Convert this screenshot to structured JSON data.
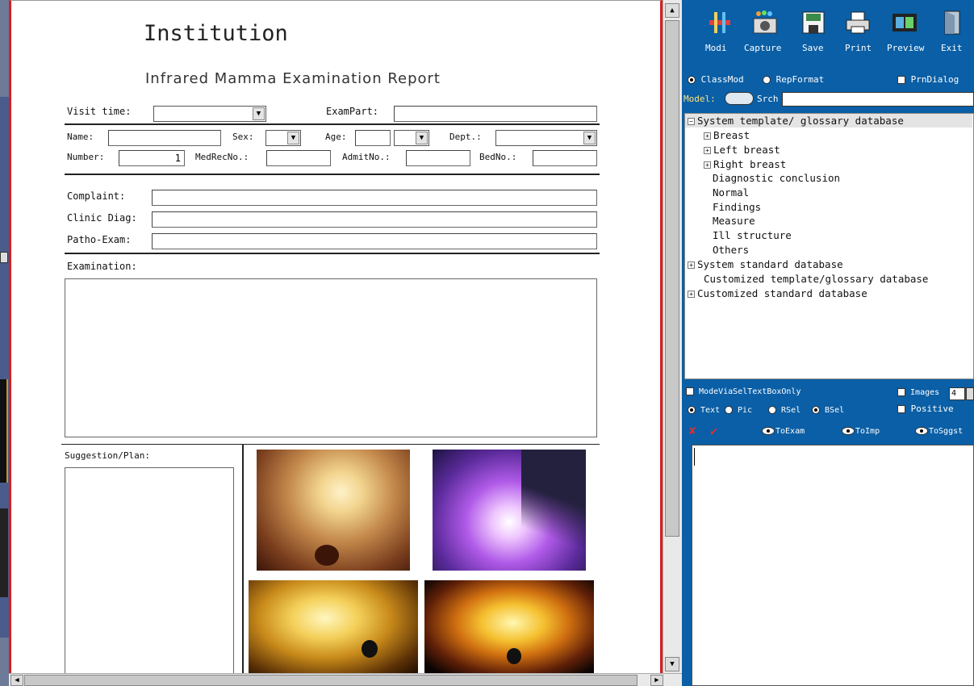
{
  "report": {
    "institution": "Institution",
    "title": "Infrared Mamma Examination Report",
    "visit_time_label": "Visit time:",
    "exam_part_label": "ExamPart:",
    "name_label": "Name:",
    "sex_label": "Sex:",
    "age_label": "Age:",
    "dept_label": "Dept.:",
    "number_label": "Number:",
    "number_value": "1",
    "medrec_label": "MedRecNo.:",
    "admit_label": "AdmitNo.:",
    "bed_label": "BedNo.:",
    "complaint_label": "Complaint:",
    "clinic_diag_label": "Clinic Diag:",
    "patho_exam_label": "Patho-Exam:",
    "examination_label": "Examination:",
    "suggestion_label": "Suggestion/Plan:"
  },
  "toolbar": {
    "items": [
      {
        "label": "Modi",
        "icon": "tools-icon"
      },
      {
        "label": "Capture",
        "icon": "camera-icon"
      },
      {
        "label": "Save",
        "icon": "floppy-icon"
      },
      {
        "label": "Print",
        "icon": "printer-icon"
      },
      {
        "label": "Preview",
        "icon": "film-icon"
      },
      {
        "label": "Exit",
        "icon": "door-icon"
      }
    ]
  },
  "options": {
    "classmod": "ClassMod",
    "repformat": "RepFormat",
    "prndialog": "PrnDialog",
    "model_label": "Model:",
    "srch": "Srch"
  },
  "tree": {
    "items": [
      {
        "label": "System template/ glossary database",
        "expander": "−"
      },
      {
        "label": "Breast",
        "expander": "+"
      },
      {
        "label": "Left breast",
        "expander": "+"
      },
      {
        "label": "Right breast",
        "expander": "+"
      },
      {
        "label": "Diagnostic conclusion"
      },
      {
        "label": "Normal"
      },
      {
        "label": "Findings"
      },
      {
        "label": "Measure"
      },
      {
        "label": "Ill structure"
      },
      {
        "label": "Others"
      },
      {
        "label": "System standard database",
        "expander": "+"
      },
      {
        "label": "Customized template/glossary database"
      },
      {
        "label": "Customized standard database",
        "expander": "+"
      }
    ]
  },
  "lower": {
    "mode_label": "ModeViaSelTextBoxOnly",
    "images_label": "Images",
    "images_value": "4",
    "positive_label": "Positive",
    "text_label": "Text",
    "pic_label": "Pic",
    "rsel_label": "RSel",
    "bsel_label": "BSel",
    "to_exam": "ToExam",
    "to_imp": "ToImp",
    "to_sggst": "ToSggst"
  },
  "colors": {
    "panel_blue": "#0a5fa6",
    "doc_border_red": "#d42020"
  }
}
